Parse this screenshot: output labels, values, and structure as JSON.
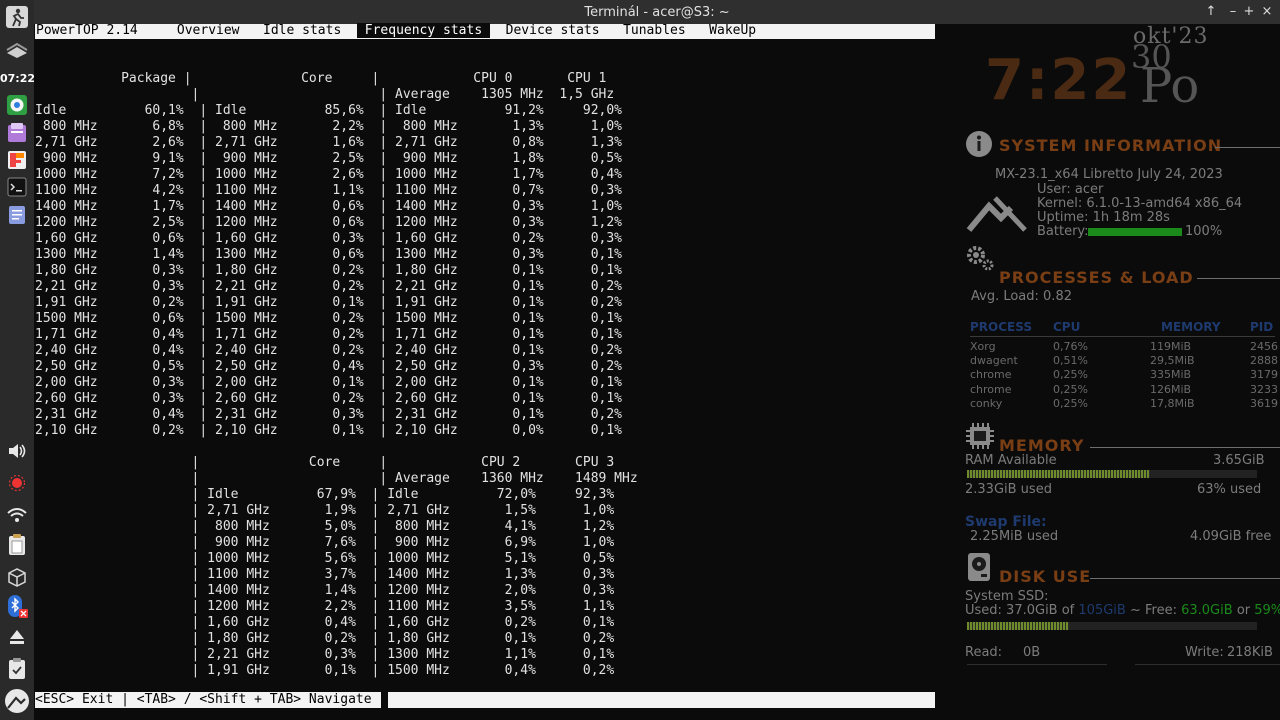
{
  "panel": {
    "clock": "07:22",
    "colors": {
      "background": "#2a2a2a"
    },
    "items": [
      {
        "name": "app-menu-icon"
      },
      {
        "name": "show-desktop-icon"
      },
      {
        "name": "chrome-icon"
      },
      {
        "name": "file-manager-icon"
      },
      {
        "name": "firefox-icon"
      },
      {
        "name": "terminal-icon"
      },
      {
        "name": "text-editor-icon"
      },
      {
        "name": "volume-icon"
      },
      {
        "name": "update-icon"
      },
      {
        "name": "wifi-icon"
      },
      {
        "name": "clipboard-icon"
      },
      {
        "name": "package-icon"
      },
      {
        "name": "bluetooth-icon"
      },
      {
        "name": "eject-icon"
      },
      {
        "name": "clipboard-check-icon"
      },
      {
        "name": "mx-logo-icon"
      }
    ]
  },
  "window": {
    "title": "Terminál - acer@S3: ~",
    "buttons": {
      "up": "↑",
      "minimize": "–",
      "maximize": "+",
      "close": "×"
    }
  },
  "powertop": {
    "app_name": "PowerTOP 2.14",
    "tabs": [
      "Overview",
      "Idle stats",
      "Frequency stats",
      "Device stats",
      "Tunables",
      "WakeUp"
    ],
    "active_tab": "Frequency stats",
    "table1": {
      "header": [
        "Package",
        "Core",
        "CPU 0",
        "CPU 1"
      ],
      "average": [
        "1305 MHz",
        "1,5 GHz"
      ],
      "rows": [
        [
          "Idle",
          "60,1%",
          "Idle",
          "85,6%",
          "Idle",
          "91,2%",
          "92,0%"
        ],
        [
          " 800 MHz",
          "6,8%",
          " 800 MHz",
          "2,2%",
          " 800 MHz",
          "1,3%",
          "1,0%"
        ],
        [
          "2,71 GHz",
          "2,6%",
          "2,71 GHz",
          "1,6%",
          "2,71 GHz",
          "0,8%",
          "1,3%"
        ],
        [
          " 900 MHz",
          "9,1%",
          " 900 MHz",
          "2,5%",
          " 900 MHz",
          "1,8%",
          "0,5%"
        ],
        [
          "1000 MHz",
          "7,2%",
          "1000 MHz",
          "2,6%",
          "1000 MHz",
          "1,7%",
          "0,4%"
        ],
        [
          "1100 MHz",
          "4,2%",
          "1100 MHz",
          "1,1%",
          "1100 MHz",
          "0,7%",
          "0,3%"
        ],
        [
          "1400 MHz",
          "1,7%",
          "1400 MHz",
          "0,6%",
          "1400 MHz",
          "0,3%",
          "1,0%"
        ],
        [
          "1200 MHz",
          "2,5%",
          "1200 MHz",
          "0,6%",
          "1200 MHz",
          "0,3%",
          "1,2%"
        ],
        [
          "1,60 GHz",
          "0,6%",
          "1,60 GHz",
          "0,3%",
          "1,60 GHz",
          "0,2%",
          "0,3%"
        ],
        [
          "1300 MHz",
          "1,4%",
          "1300 MHz",
          "0,6%",
          "1300 MHz",
          "0,3%",
          "0,1%"
        ],
        [
          "1,80 GHz",
          "0,3%",
          "1,80 GHz",
          "0,2%",
          "1,80 GHz",
          "0,1%",
          "0,1%"
        ],
        [
          "2,21 GHz",
          "0,3%",
          "2,21 GHz",
          "0,2%",
          "2,21 GHz",
          "0,1%",
          "0,2%"
        ],
        [
          "1,91 GHz",
          "0,2%",
          "1,91 GHz",
          "0,1%",
          "1,91 GHz",
          "0,1%",
          "0,2%"
        ],
        [
          "1500 MHz",
          "0,6%",
          "1500 MHz",
          "0,2%",
          "1500 MHz",
          "0,1%",
          "0,1%"
        ],
        [
          "1,71 GHz",
          "0,4%",
          "1,71 GHz",
          "0,2%",
          "1,71 GHz",
          "0,1%",
          "0,1%"
        ],
        [
          "2,40 GHz",
          "0,4%",
          "2,40 GHz",
          "0,2%",
          "2,40 GHz",
          "0,1%",
          "0,2%"
        ],
        [
          "2,50 GHz",
          "0,5%",
          "2,50 GHz",
          "0,4%",
          "2,50 GHz",
          "0,3%",
          "0,2%"
        ],
        [
          "2,00 GHz",
          "0,3%",
          "2,00 GHz",
          "0,1%",
          "2,00 GHz",
          "0,1%",
          "0,1%"
        ],
        [
          "2,60 GHz",
          "0,3%",
          "2,60 GHz",
          "0,2%",
          "2,60 GHz",
          "0,1%",
          "0,1%"
        ],
        [
          "2,31 GHz",
          "0,4%",
          "2,31 GHz",
          "0,3%",
          "2,31 GHz",
          "0,1%",
          "0,2%"
        ],
        [
          "2,10 GHz",
          "0,2%",
          "2,10 GHz",
          "0,1%",
          "2,10 GHz",
          "0,0%",
          "0,1%"
        ]
      ]
    },
    "table2": {
      "header": [
        "Core",
        "CPU 2",
        "CPU 3"
      ],
      "average": [
        "1360 MHz",
        "1489 MHz"
      ],
      "rows": [
        [
          "Idle",
          "67,9%",
          "Idle",
          "72,0%",
          "92,3%"
        ],
        [
          "2,71 GHz",
          "1,9%",
          "2,71 GHz",
          "1,5%",
          "1,0%"
        ],
        [
          " 800 MHz",
          "5,0%",
          " 800 MHz",
          "4,1%",
          "1,2%"
        ],
        [
          " 900 MHz",
          "7,6%",
          " 900 MHz",
          "6,9%",
          "1,0%"
        ],
        [
          "1000 MHz",
          "5,6%",
          "1000 MHz",
          "5,1%",
          "0,5%"
        ],
        [
          "1100 MHz",
          "3,7%",
          "1400 MHz",
          "1,3%",
          "0,3%"
        ],
        [
          "1400 MHz",
          "1,4%",
          "1200 MHz",
          "2,0%",
          "0,3%"
        ],
        [
          "1200 MHz",
          "2,2%",
          "1100 MHz",
          "3,5%",
          "1,1%"
        ],
        [
          "1,60 GHz",
          "0,4%",
          "1,60 GHz",
          "0,2%",
          "0,1%"
        ],
        [
          "1,80 GHz",
          "0,2%",
          "1,80 GHz",
          "0,1%",
          "0,2%"
        ],
        [
          "2,21 GHz",
          "0,3%",
          "1300 MHz",
          "1,1%",
          "0,1%"
        ],
        [
          "1,91 GHz",
          "0,1%",
          "1500 MHz",
          "0,4%",
          "0,2%"
        ]
      ]
    },
    "average_label": "Average",
    "status_bar": "<ESC> Exit | <TAB> / <Shift + TAB> Navigate |"
  },
  "conky": {
    "time": "7:22",
    "day_number": "30",
    "month_year": "okt'23",
    "day_abbr": "Po",
    "colors": {
      "accent": "#7a3e14",
      "text": "#7c7c7c",
      "bar_green": "#1a8a1a",
      "swap_blue": "#1e3a6e"
    },
    "system": {
      "title": "SYSTEM INFORMATION",
      "distro": "MX-23.1_x64 Libretto July 24, 2023",
      "user": "User: acer",
      "kernel": "Kernel: 6.1.0-13-amd64 x86_64",
      "uptime": "Uptime: 1h 18m 28s",
      "battery_label": "Battery:",
      "battery_value": "100%",
      "battery_fraction": 1.0
    },
    "processes": {
      "title": "PROCESSES & LOAD",
      "avg_load": "Avg. Load: 0.82",
      "headers": [
        "PROCESS",
        "CPU",
        "MEMORY",
        "PID"
      ],
      "rows": [
        [
          "Xorg",
          "0,76%",
          "119MiB",
          "2456"
        ],
        [
          "dwagent",
          "0,51%",
          "29,5MiB",
          "2888"
        ],
        [
          "chrome",
          "0,25%",
          "335MiB",
          "3179"
        ],
        [
          "chrome",
          "0,25%",
          "126MiB",
          "3233"
        ],
        [
          "conky",
          "0,25%",
          "17,8MiB",
          "3619"
        ]
      ]
    },
    "memory": {
      "title": "MEMORY",
      "ram_label": "RAM Available",
      "ram_value": "3.65GiB",
      "used_label": "2.33GiB used",
      "used_percent": "63% used",
      "used_fraction": 0.63,
      "swap_title": "Swap File:",
      "swap_used": "2.25MiB used",
      "swap_free": "4.09GiB free"
    },
    "disk": {
      "title": "DISK USE",
      "label": "System SSD:",
      "used_prefix": "Used: 37.0GiB of",
      "total": "105GiB",
      "free_prefix": "~ Free:",
      "free": "63.0GiB",
      "or": "or",
      "free_percent": "59%",
      "used_fraction": 0.35,
      "read_label": "Read:",
      "read_value": "0B",
      "write_label": "Write:",
      "write_value": "218KiB"
    }
  }
}
